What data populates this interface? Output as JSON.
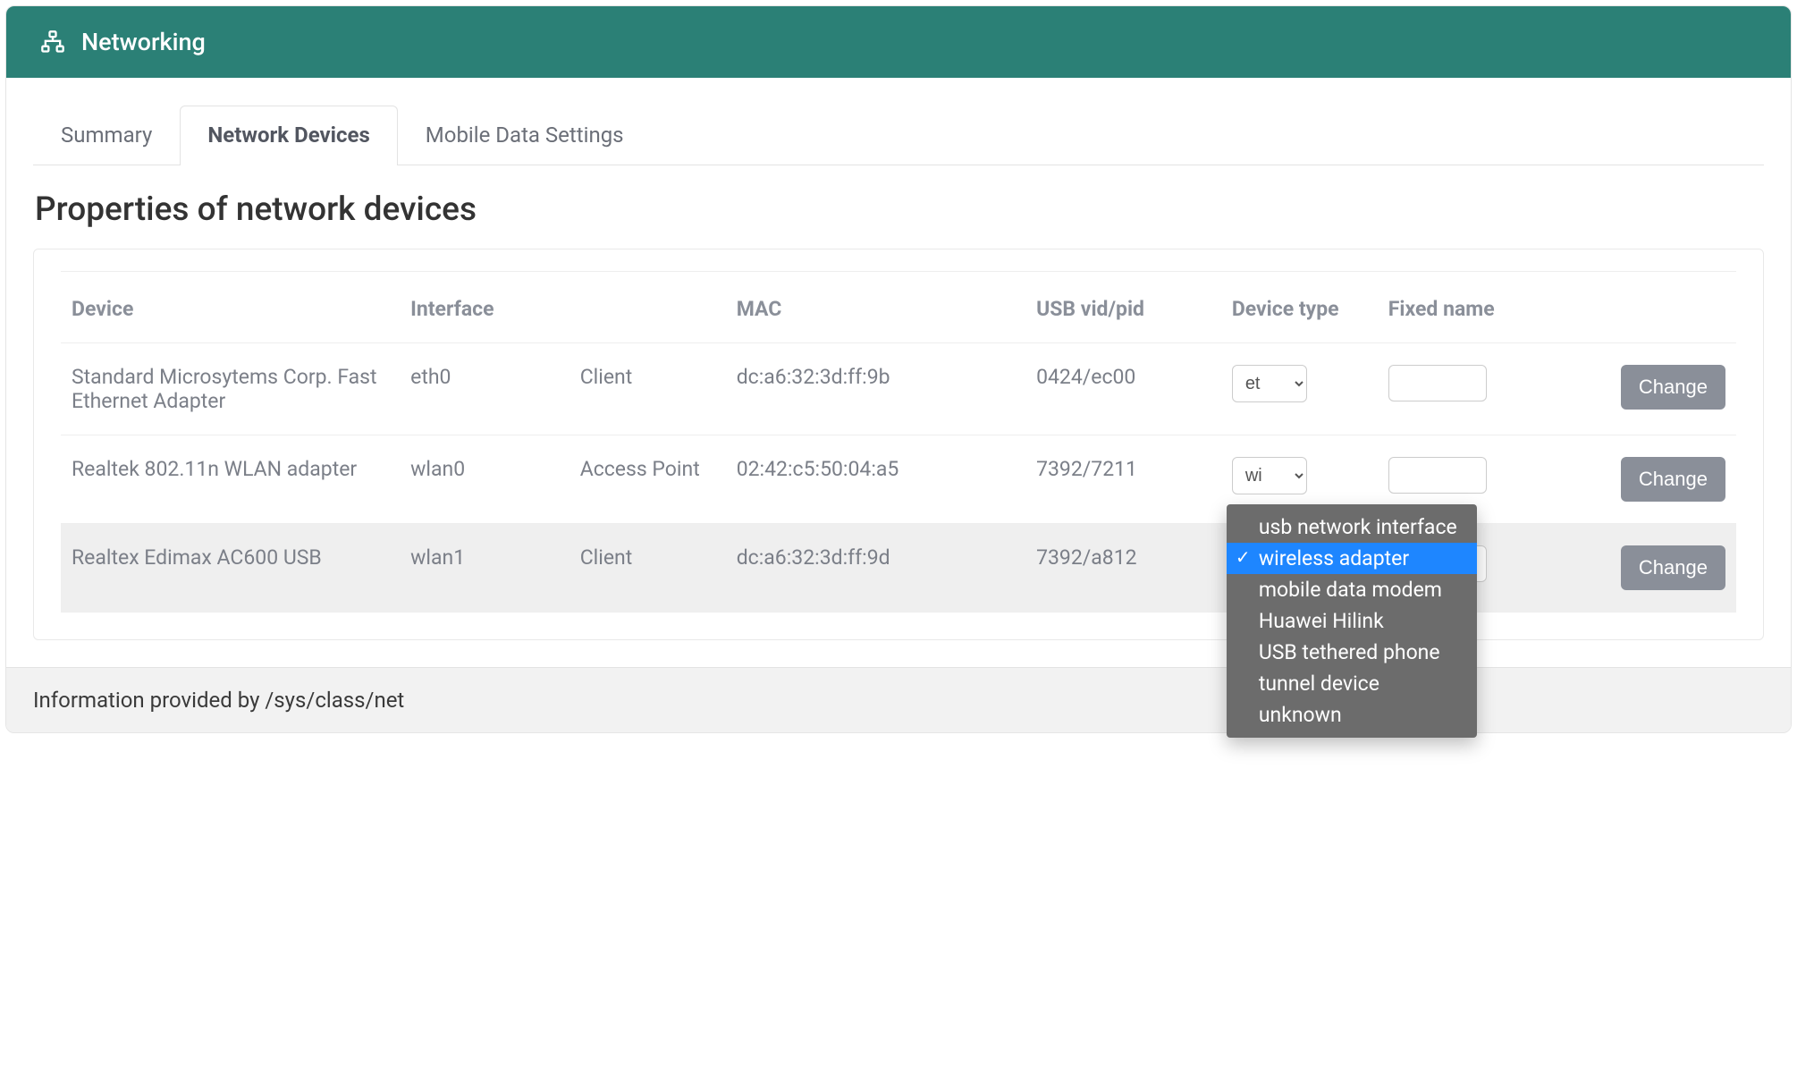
{
  "header": {
    "title": "Networking"
  },
  "tabs": [
    {
      "label": "Summary",
      "active": false
    },
    {
      "label": "Network Devices",
      "active": true
    },
    {
      "label": "Mobile Data Settings",
      "active": false
    }
  ],
  "section_title": "Properties of network devices",
  "columns": {
    "device": "Device",
    "interface": "Interface",
    "mode": "",
    "mac": "MAC",
    "usb": "USB vid/pid",
    "type": "Device type",
    "name": "Fixed name",
    "action": ""
  },
  "rows": [
    {
      "device": "Standard Microsytems Corp. Fast Ethernet Adapter",
      "interface": "eth0",
      "mode": "Client",
      "mac": "dc:a6:32:3d:ff:9b",
      "usb": "0424/ec00",
      "type_display": "et",
      "fixed_name": "",
      "action": "Change",
      "highlight": false
    },
    {
      "device": "Realtek 802.11n WLAN adapter",
      "interface": "wlan0",
      "mode": "Access Point",
      "mac": "02:42:c5:50:04:a5",
      "usb": "7392/7211",
      "type_display": "wi",
      "fixed_name": "",
      "action": "Change",
      "highlight": false
    },
    {
      "device": "Realtex Edimax AC600 USB",
      "interface": "wlan1",
      "mode": "Client",
      "mac": "dc:a6:32:3d:ff:9d",
      "usb": "7392/a812",
      "type_display": "",
      "fixed_name": "",
      "action": "Change",
      "highlight": true
    }
  ],
  "device_type_options": [
    "usb network interface",
    "wireless adapter",
    "mobile data modem",
    "Huawei Hilink",
    "USB tethered phone",
    "tunnel device",
    "unknown"
  ],
  "dropdown_selected_index": 1,
  "footer_text": "Information provided by /sys/class/net"
}
